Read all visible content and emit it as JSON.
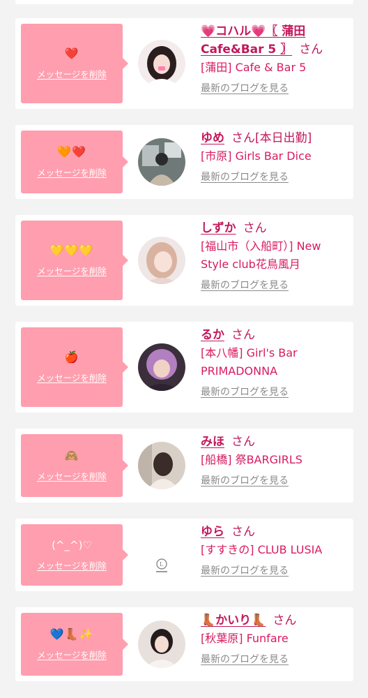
{
  "labels": {
    "delete_message": "メッセージを削除",
    "latest_blog": "最新のブログを見る",
    "honorific": "さん"
  },
  "colors": {
    "bubble": "#ff9eae",
    "name": "#c2185b",
    "shop": "#d81b60",
    "link_gray": "#8a8a8a",
    "background": "#f3f3f3"
  },
  "items": [
    {
      "message": "❤️",
      "message_icons": [
        "red-heart-icon"
      ],
      "name": "💗コハル💗〖 蒲田Cafe&Bar 5 〗",
      "shop": "[蒲田] Cafe & Bar 5"
    },
    {
      "message": "🧡❤️",
      "message_icons": [
        "orange-heart-icon",
        "red-heart-icon"
      ],
      "name": "ゆめ",
      "name_suffix": "[本日出勤]",
      "shop": "[市原] Girls Bar Dice"
    },
    {
      "message": "💛💛💛",
      "message_icons": [
        "yellow-heart-icon",
        "yellow-heart-icon",
        "yellow-heart-icon"
      ],
      "name": "しずか",
      "shop": "[福山市（入船町）] New Style club花鳥風月"
    },
    {
      "message": "🍎",
      "message_icons": [
        "apple-icon"
      ],
      "name": "るか",
      "shop": "[本八幡] Girl's Bar PRIMADONNA"
    },
    {
      "message": "🙈",
      "message_icons": [
        "see-no-evil-monkey-icon"
      ],
      "name": "みほ",
      "shop": "[船橋] 祭BARGIRLS"
    },
    {
      "message": "(^_^)♡",
      "name": "ゆら",
      "shop": "[すすきの] CLUB LUSIA"
    },
    {
      "message": "💙👢✨",
      "message_icons": [
        "blue-heart-icon",
        "boot-icon",
        "sparkles-icon"
      ],
      "name": "👢かいり👢",
      "shop": "[秋葉原] Funfare"
    }
  ]
}
